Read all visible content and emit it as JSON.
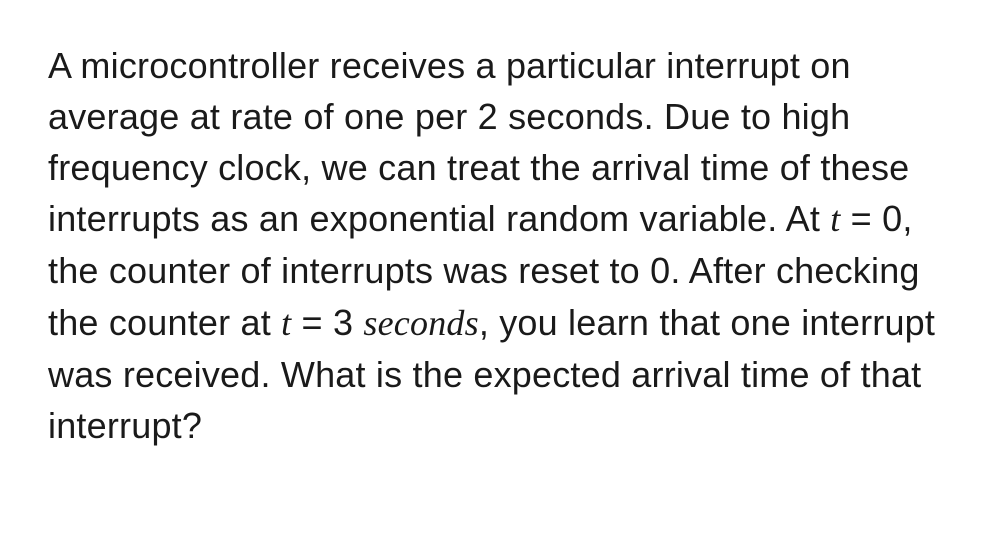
{
  "question": {
    "part1": "A microcontroller receives a particular interrupt on average at rate of one per 2 seconds. Due to high frequency clock, we can treat the arrival time of these interrupts as an exponential random variable. At ",
    "var1": "t",
    "part2": " = 0, the counter of interrupts was reset to 0. After checking the counter at ",
    "var2": "t",
    "part3": " = 3 ",
    "var3": "seconds",
    "part4": ", you learn that one interrupt was received. What is the expected arrival time of that interrupt?"
  }
}
